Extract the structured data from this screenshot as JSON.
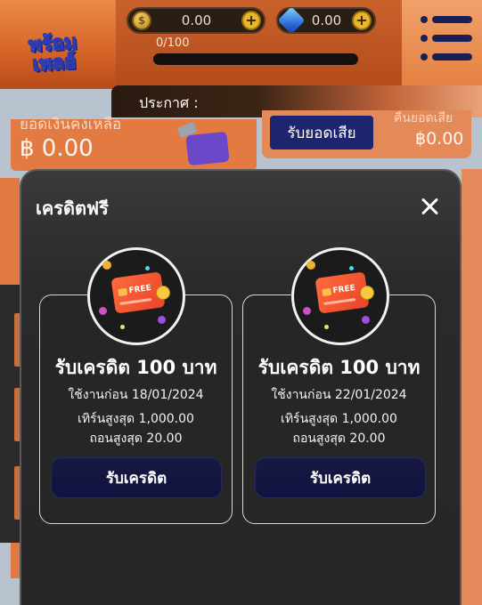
{
  "header": {
    "coin_balance": "0.00",
    "gem_balance": "0.00",
    "progress_label": "0/100",
    "progress_fraction": 0.0,
    "logo_text_line1": "พร้อม",
    "logo_text_line2": "เพลย์",
    "announcement_label": "ประกาศ :"
  },
  "background": {
    "wallet_title": "ยอดเงินคงเหลือ",
    "wallet_amount": "฿ 0.00",
    "claim_loss_button": "รับยอดเสีย",
    "loss_title": "คืนยอดเสีย",
    "loss_amount": "฿0.00"
  },
  "modal": {
    "title": "เครดิตฟรี",
    "cards": [
      {
        "heading": "รับเครดิต 100 บาท",
        "use_before": "ใช้งานก่อน 18/01/2024",
        "max_turnover": "เทิร์นสูงสุด 1,000.00",
        "max_withdraw": "ถอนสูงสุด 20.00",
        "button_label": "รับเครดิต",
        "badge_text": "FREE"
      },
      {
        "heading": "รับเครดิต 100 บาท",
        "use_before": "ใช้งานก่อน 22/01/2024",
        "max_turnover": "เทิร์นสูงสุด 1,000.00",
        "max_withdraw": "ถอนสูงสุด 20.00",
        "button_label": "รับเครดิต",
        "badge_text": "FREE"
      }
    ]
  },
  "colors": {
    "header_orange": "#d9662a",
    "modal_bg": "#2a2a2a",
    "button_navy": "#101240",
    "accent_gold": "#e9b52a"
  },
  "icons": [
    "coin-icon",
    "gem-icon",
    "plus-icon",
    "menu-icon",
    "close-icon",
    "free-credit-card-icon"
  ]
}
